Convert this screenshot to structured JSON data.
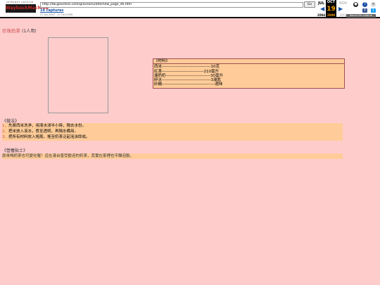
{
  "toolbar": {
    "small_text": "INTERNET ARCHIVE",
    "logo": "WaybackMachine",
    "url": "http://tw.geocities.com/gracesss2000/new_page_46.htm",
    "go_label": "Go",
    "captures": "16 captures",
    "capture_range": "27 Jun 2007 - 27 Oct 2009",
    "months": [
      "JUL",
      "OCT",
      "NOV"
    ],
    "day": "19",
    "years": [
      "2004",
      "2009",
      "2010"
    ],
    "about_label": "About this capture",
    "colors": {
      "accent": "#ffa500",
      "link": "#1a53a6"
    }
  },
  "page": {
    "title": "珍珠奶茶",
    "serving": "(1人用)",
    "ingredients": {
      "header": "《材料》",
      "rows": [
        "西米-----------------------------------10克",
        "紅茶------------------------------210毫升",
        "煉奶奶--------------------------------30毫升",
        "碎冰-----------------------------------3湯匙",
        "砂糖--------------------------------------適味"
      ]
    },
    "method_title": "《做法》",
    "steps": [
      {
        "num": "1、",
        "text": "先將西米洗淨，用清水浸半小時，隔去水份。"
      },
      {
        "num": "2、",
        "text": "把米放入滾水，煮至透明，再隔水備用。"
      },
      {
        "num": "3、",
        "text": "把所有材料放入搖瓶，搖至奶茶泛起泡沫即成。"
      }
    ],
    "tips_title": "《營養貼士》",
    "tip": "原來喝奶茶也可變化喔！這在港台普受歡迎的奶茶，其實在家裡也不難泡製。",
    "colors": {
      "background": "#ffcccc",
      "box": "#ffcc99",
      "title": "#cc5555"
    }
  }
}
